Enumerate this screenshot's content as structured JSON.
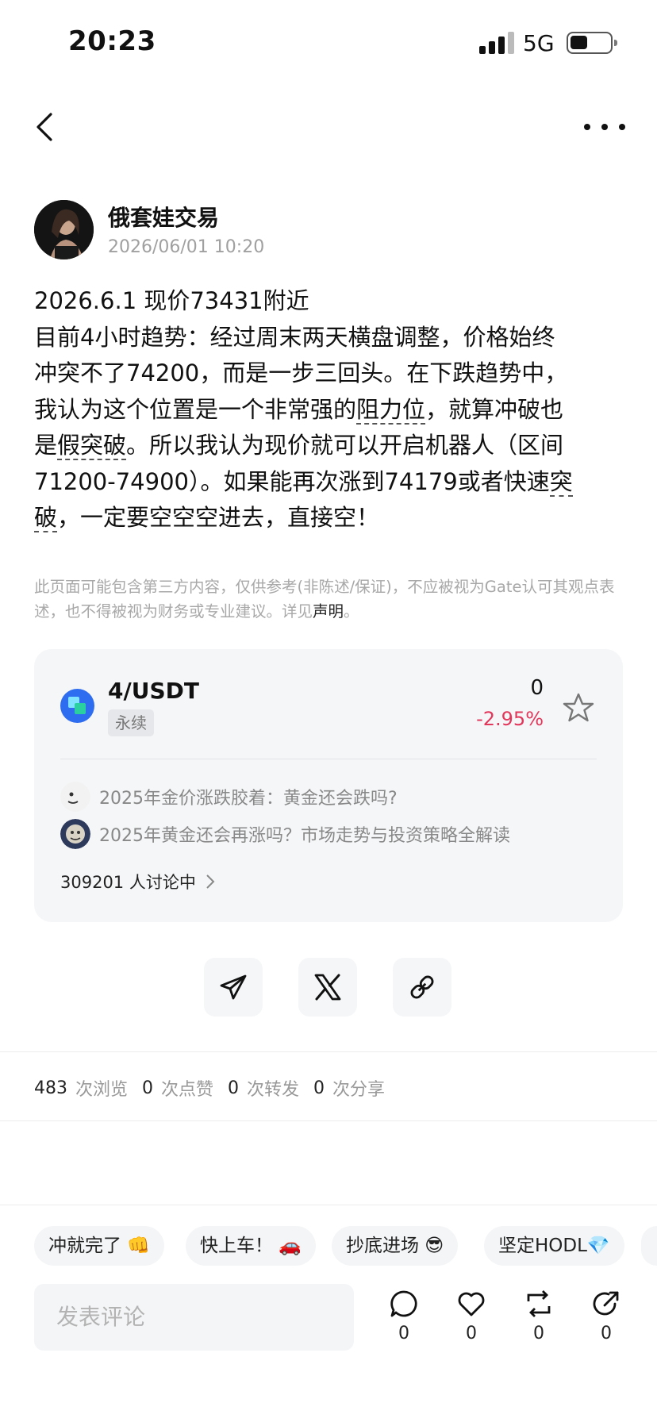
{
  "status_bar": {
    "time": "20:23",
    "network": "5G",
    "battery_level": 0.45
  },
  "author": {
    "name": "俄套娃交易",
    "timestamp": "2026/06/01 10:20"
  },
  "post": {
    "lines": [
      "2026.6.1 现价73431附近",
      "目前4小时趋势：经过周末两天横盘调整，价格始终",
      "冲突不了74200，而是一步三回头。在下跌趋势中，"
    ],
    "line4_prefix": "我认为这个位置是一个非常强的",
    "line4_link": "阻力位",
    "line4_suffix": "，就算冲破也",
    "line5_prefix": "是",
    "line5_link": "假突破",
    "line5_suffix": "。所以我认为现价就可以开启机器人（区间",
    "line6_prefix": "71200-74900）。如果能再次涨到74179或者快速",
    "line6_link": "突",
    "line7_link": "破",
    "line7_suffix": "，一定要空空空进去，直接空！"
  },
  "disclaimer": {
    "text": "此页面可能包含第三方内容，仅供参考(非陈述/保证)，不应被视为Gate认可其观点表述，也不得被视为财务或专业建议。详见",
    "link": "声明",
    "tail": "。"
  },
  "market_card": {
    "pair": "4/USDT",
    "tag": "永续",
    "price": "0",
    "change": "-2.95%",
    "change_color": "#e2365a",
    "topics": [
      "2025年金价涨跌胶着：黄金还会跌吗?",
      "2025年黄金还会再涨吗？市场走势与投资策略全解读"
    ],
    "discussion": "309201 人讨论中"
  },
  "share": {
    "icons": [
      "telegram-icon",
      "x-logo-icon",
      "link-icon"
    ]
  },
  "stats": {
    "views": "483",
    "views_label": "次浏览",
    "likes": "0",
    "likes_label": "次点赞",
    "reposts": "0",
    "reposts_label": "次转发",
    "shares": "0",
    "shares_label": "次分享"
  },
  "quick_replies": [
    "冲就完了 👊",
    "快上车！ 🚗",
    "抄底进场 😎",
    "坚定HODL💎"
  ],
  "comment": {
    "placeholder": "发表评论"
  },
  "actions": {
    "comment_count": "0",
    "like_count": "0",
    "repost_count": "0",
    "share_count": "0"
  }
}
